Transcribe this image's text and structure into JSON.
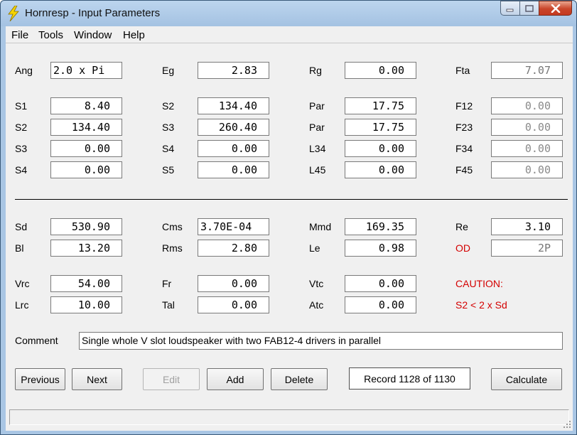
{
  "window": {
    "title": "Hornresp - Input Parameters"
  },
  "menu": [
    "File",
    "Tools",
    "Window",
    "Help"
  ],
  "rows": {
    "ang": {
      "label": "Ang",
      "value": "2.0 x Pi"
    },
    "eg": {
      "label": "Eg",
      "value": "2.83"
    },
    "rg": {
      "label": "Rg",
      "value": "0.00"
    },
    "fta": {
      "label": "Fta",
      "value": "7.07"
    },
    "s1": {
      "label": "S1",
      "value": "8.40"
    },
    "s2a": {
      "label": "S2",
      "value": "134.40"
    },
    "par1": {
      "label": "Par",
      "value": "17.75"
    },
    "f12": {
      "label": "F12",
      "value": "0.00"
    },
    "s2b": {
      "label": "S2",
      "value": "134.40"
    },
    "s3a": {
      "label": "S3",
      "value": "260.40"
    },
    "par2": {
      "label": "Par",
      "value": "17.75"
    },
    "f23": {
      "label": "F23",
      "value": "0.00"
    },
    "s3b": {
      "label": "S3",
      "value": "0.00"
    },
    "s4a": {
      "label": "S4",
      "value": "0.00"
    },
    "l34": {
      "label": "L34",
      "value": "0.00"
    },
    "f34": {
      "label": "F34",
      "value": "0.00"
    },
    "s4b": {
      "label": "S4",
      "value": "0.00"
    },
    "s5": {
      "label": "S5",
      "value": "0.00"
    },
    "l45": {
      "label": "L45",
      "value": "0.00"
    },
    "f45": {
      "label": "F45",
      "value": "0.00"
    },
    "sd": {
      "label": "Sd",
      "value": "530.90"
    },
    "cms": {
      "label": "Cms",
      "value": "3.70E-04"
    },
    "mmd": {
      "label": "Mmd",
      "value": "169.35"
    },
    "re": {
      "label": "Re",
      "value": "3.10"
    },
    "bl": {
      "label": "Bl",
      "value": "13.20"
    },
    "rms": {
      "label": "Rms",
      "value": "2.80"
    },
    "le": {
      "label": "Le",
      "value": "0.98"
    },
    "od": {
      "label": "OD",
      "value": "2P"
    },
    "vrc": {
      "label": "Vrc",
      "value": "54.00"
    },
    "fr": {
      "label": "Fr",
      "value": "0.00"
    },
    "vtc": {
      "label": "Vtc",
      "value": "0.00"
    },
    "lrc": {
      "label": "Lrc",
      "value": "10.00"
    },
    "tal": {
      "label": "Tal",
      "value": "0.00"
    },
    "atc": {
      "label": "Atc",
      "value": "0.00"
    }
  },
  "caution": {
    "title": "CAUTION:",
    "message": "S2 < 2 x Sd"
  },
  "comment": {
    "label": "Comment",
    "value": "Single whole V slot loudspeaker with two FAB12-4 drivers in parallel"
  },
  "buttons": {
    "previous": "Previous",
    "next": "Next",
    "edit": "Edit",
    "add": "Add",
    "delete": "Delete",
    "calculate": "Calculate"
  },
  "record": "Record 1128 of 1130",
  "colors": {
    "caution": "#d40000",
    "titlebar": "#a9c6e4"
  }
}
